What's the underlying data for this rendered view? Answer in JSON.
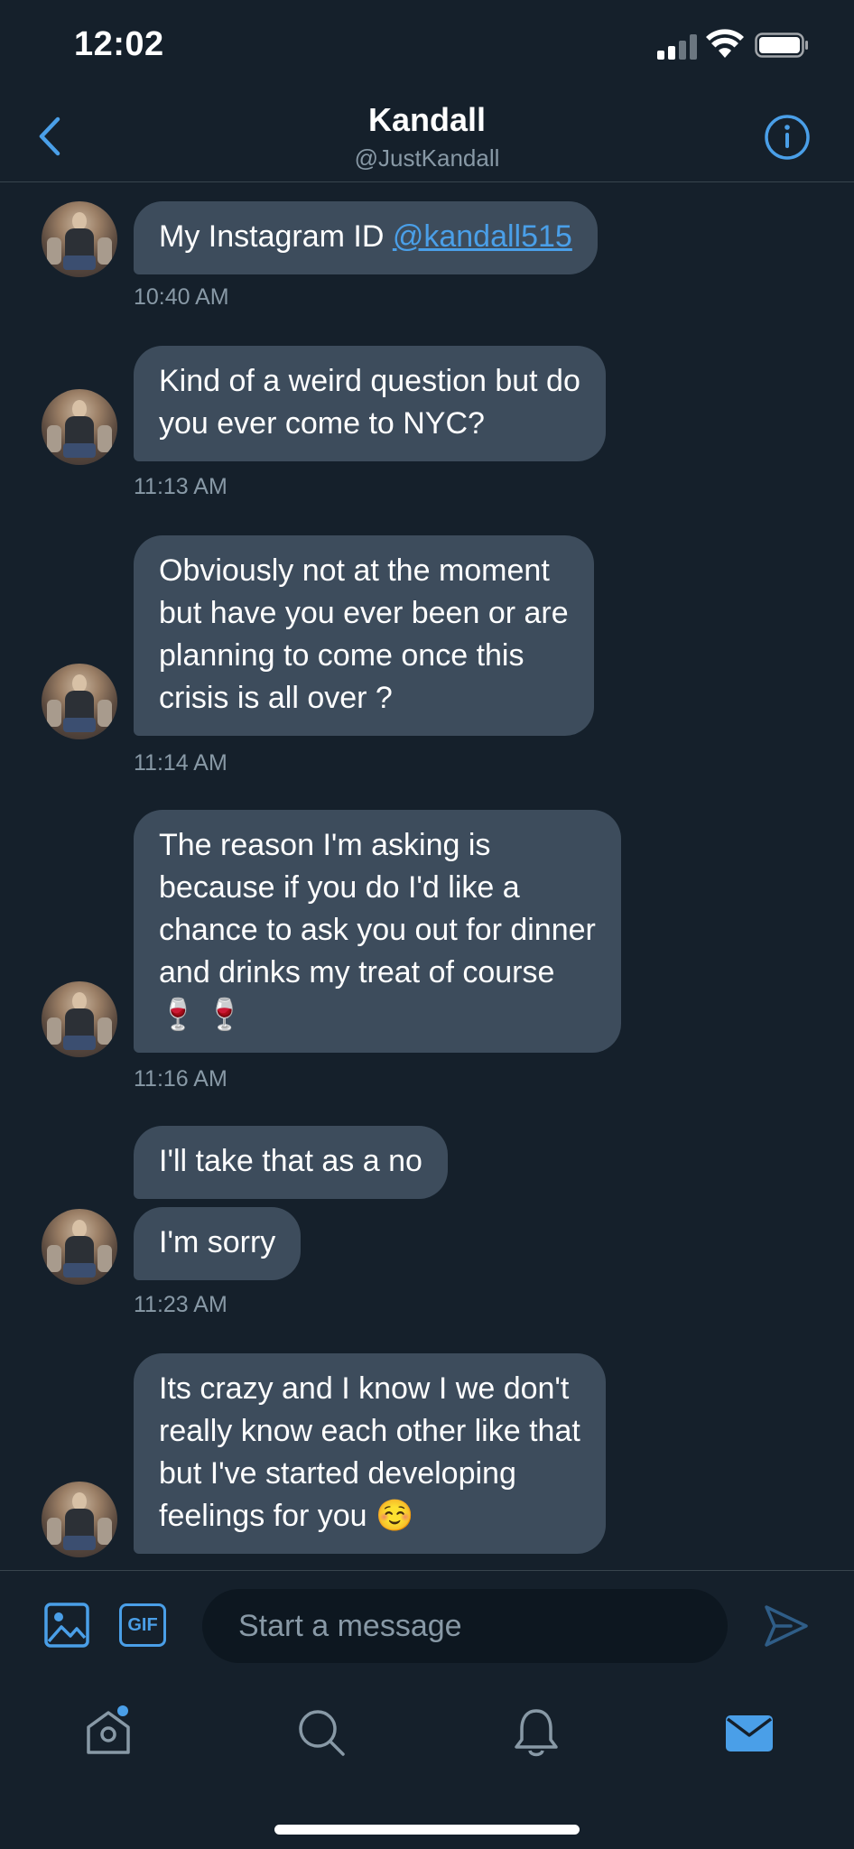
{
  "status_bar": {
    "time": "12:02"
  },
  "header": {
    "name": "Kandall",
    "handle": "@JustKandall"
  },
  "messages": [
    {
      "text": "My Instagram ID ",
      "link": "@kandall515",
      "time": "10:40 AM"
    },
    {
      "lines": [
        "Kind of a weird question but do",
        "you ever come to NYC?"
      ],
      "time": "11:13 AM"
    },
    {
      "lines": [
        "Obviously not at the moment",
        "but have you ever been or are",
        "planning to come once this",
        "crisis is all over ?"
      ],
      "time": "11:14 AM"
    },
    {
      "lines": [
        "The reason I'm asking is",
        "because if you do I'd like a",
        "chance to ask you out for dinner",
        "and drinks my treat of course",
        "🍷 🍷"
      ],
      "time": "11:16 AM"
    },
    {
      "text": "I'll take that as a no"
    },
    {
      "text": "I'm sorry",
      "time": "11:23 AM"
    },
    {
      "lines": [
        "Its crazy and I know I we don't",
        "really know each other like that",
        "but I've started developing",
        "feelings for you ☺️"
      ]
    }
  ],
  "compose": {
    "placeholder": "Start a message",
    "gif_label": "GIF"
  },
  "tabs": [
    "home-icon",
    "search-icon",
    "bell-icon",
    "mail-icon"
  ],
  "colors": {
    "background": "#15202b",
    "bubble": "#3d4c5c",
    "accent": "#4a9fe8",
    "muted": "#8899a6"
  }
}
